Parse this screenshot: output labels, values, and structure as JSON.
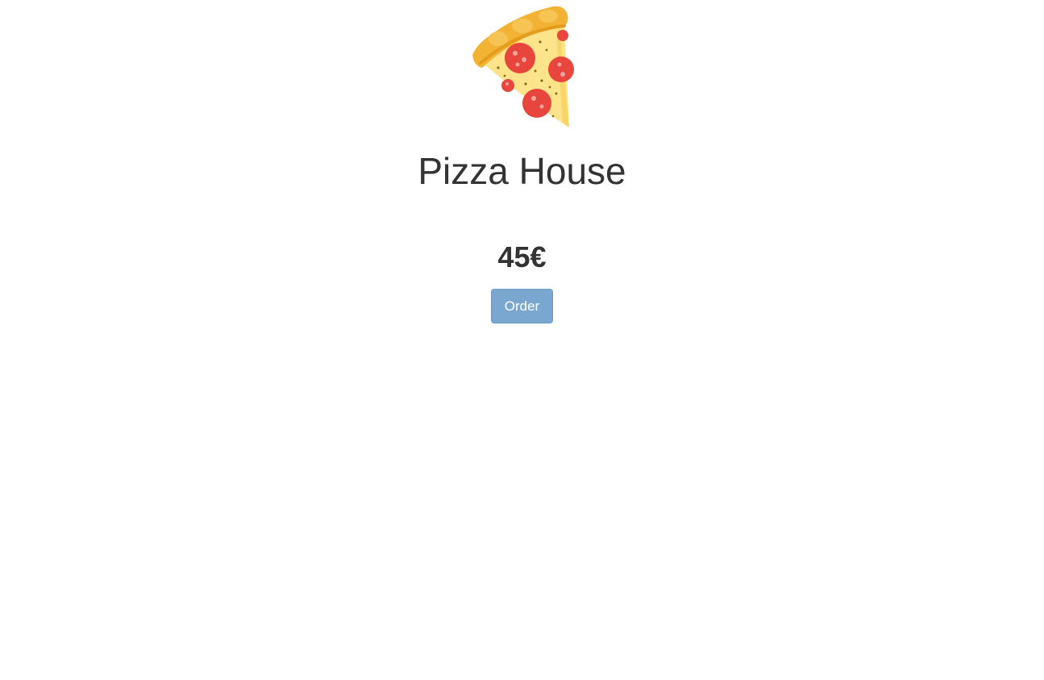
{
  "logo": {
    "icon": "pizza-slice-icon",
    "colors": {
      "crust": "#f2b233",
      "crust_dark": "#e39c1c",
      "cheese": "#fde38a",
      "pepperoni": "#e8453c",
      "pepperoni_spot": "#f7a1a1"
    }
  },
  "header": {
    "title": "Pizza House"
  },
  "product": {
    "price": "45€"
  },
  "actions": {
    "order_label": "Order",
    "button_color": "#7aa7cf"
  }
}
